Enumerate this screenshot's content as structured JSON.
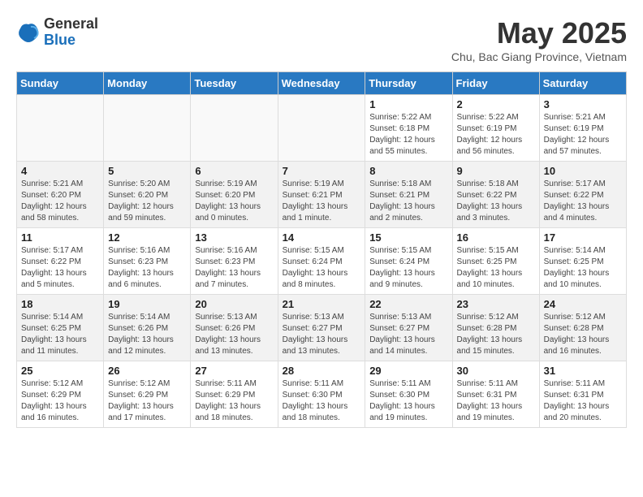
{
  "logo": {
    "general": "General",
    "blue": "Blue"
  },
  "title": "May 2025",
  "subtitle": "Chu, Bac Giang Province, Vietnam",
  "headers": [
    "Sunday",
    "Monday",
    "Tuesday",
    "Wednesday",
    "Thursday",
    "Friday",
    "Saturday"
  ],
  "weeks": [
    [
      {
        "day": "",
        "info": ""
      },
      {
        "day": "",
        "info": ""
      },
      {
        "day": "",
        "info": ""
      },
      {
        "day": "",
        "info": ""
      },
      {
        "day": "1",
        "info": "Sunrise: 5:22 AM\nSunset: 6:18 PM\nDaylight: 12 hours\nand 55 minutes."
      },
      {
        "day": "2",
        "info": "Sunrise: 5:22 AM\nSunset: 6:19 PM\nDaylight: 12 hours\nand 56 minutes."
      },
      {
        "day": "3",
        "info": "Sunrise: 5:21 AM\nSunset: 6:19 PM\nDaylight: 12 hours\nand 57 minutes."
      }
    ],
    [
      {
        "day": "4",
        "info": "Sunrise: 5:21 AM\nSunset: 6:20 PM\nDaylight: 12 hours\nand 58 minutes."
      },
      {
        "day": "5",
        "info": "Sunrise: 5:20 AM\nSunset: 6:20 PM\nDaylight: 12 hours\nand 59 minutes."
      },
      {
        "day": "6",
        "info": "Sunrise: 5:19 AM\nSunset: 6:20 PM\nDaylight: 13 hours\nand 0 minutes."
      },
      {
        "day": "7",
        "info": "Sunrise: 5:19 AM\nSunset: 6:21 PM\nDaylight: 13 hours\nand 1 minute."
      },
      {
        "day": "8",
        "info": "Sunrise: 5:18 AM\nSunset: 6:21 PM\nDaylight: 13 hours\nand 2 minutes."
      },
      {
        "day": "9",
        "info": "Sunrise: 5:18 AM\nSunset: 6:22 PM\nDaylight: 13 hours\nand 3 minutes."
      },
      {
        "day": "10",
        "info": "Sunrise: 5:17 AM\nSunset: 6:22 PM\nDaylight: 13 hours\nand 4 minutes."
      }
    ],
    [
      {
        "day": "11",
        "info": "Sunrise: 5:17 AM\nSunset: 6:22 PM\nDaylight: 13 hours\nand 5 minutes."
      },
      {
        "day": "12",
        "info": "Sunrise: 5:16 AM\nSunset: 6:23 PM\nDaylight: 13 hours\nand 6 minutes."
      },
      {
        "day": "13",
        "info": "Sunrise: 5:16 AM\nSunset: 6:23 PM\nDaylight: 13 hours\nand 7 minutes."
      },
      {
        "day": "14",
        "info": "Sunrise: 5:15 AM\nSunset: 6:24 PM\nDaylight: 13 hours\nand 8 minutes."
      },
      {
        "day": "15",
        "info": "Sunrise: 5:15 AM\nSunset: 6:24 PM\nDaylight: 13 hours\nand 9 minutes."
      },
      {
        "day": "16",
        "info": "Sunrise: 5:15 AM\nSunset: 6:25 PM\nDaylight: 13 hours\nand 10 minutes."
      },
      {
        "day": "17",
        "info": "Sunrise: 5:14 AM\nSunset: 6:25 PM\nDaylight: 13 hours\nand 10 minutes."
      }
    ],
    [
      {
        "day": "18",
        "info": "Sunrise: 5:14 AM\nSunset: 6:25 PM\nDaylight: 13 hours\nand 11 minutes."
      },
      {
        "day": "19",
        "info": "Sunrise: 5:14 AM\nSunset: 6:26 PM\nDaylight: 13 hours\nand 12 minutes."
      },
      {
        "day": "20",
        "info": "Sunrise: 5:13 AM\nSunset: 6:26 PM\nDaylight: 13 hours\nand 13 minutes."
      },
      {
        "day": "21",
        "info": "Sunrise: 5:13 AM\nSunset: 6:27 PM\nDaylight: 13 hours\nand 13 minutes."
      },
      {
        "day": "22",
        "info": "Sunrise: 5:13 AM\nSunset: 6:27 PM\nDaylight: 13 hours\nand 14 minutes."
      },
      {
        "day": "23",
        "info": "Sunrise: 5:12 AM\nSunset: 6:28 PM\nDaylight: 13 hours\nand 15 minutes."
      },
      {
        "day": "24",
        "info": "Sunrise: 5:12 AM\nSunset: 6:28 PM\nDaylight: 13 hours\nand 16 minutes."
      }
    ],
    [
      {
        "day": "25",
        "info": "Sunrise: 5:12 AM\nSunset: 6:29 PM\nDaylight: 13 hours\nand 16 minutes."
      },
      {
        "day": "26",
        "info": "Sunrise: 5:12 AM\nSunset: 6:29 PM\nDaylight: 13 hours\nand 17 minutes."
      },
      {
        "day": "27",
        "info": "Sunrise: 5:11 AM\nSunset: 6:29 PM\nDaylight: 13 hours\nand 18 minutes."
      },
      {
        "day": "28",
        "info": "Sunrise: 5:11 AM\nSunset: 6:30 PM\nDaylight: 13 hours\nand 18 minutes."
      },
      {
        "day": "29",
        "info": "Sunrise: 5:11 AM\nSunset: 6:30 PM\nDaylight: 13 hours\nand 19 minutes."
      },
      {
        "day": "30",
        "info": "Sunrise: 5:11 AM\nSunset: 6:31 PM\nDaylight: 13 hours\nand 19 minutes."
      },
      {
        "day": "31",
        "info": "Sunrise: 5:11 AM\nSunset: 6:31 PM\nDaylight: 13 hours\nand 20 minutes."
      }
    ]
  ]
}
